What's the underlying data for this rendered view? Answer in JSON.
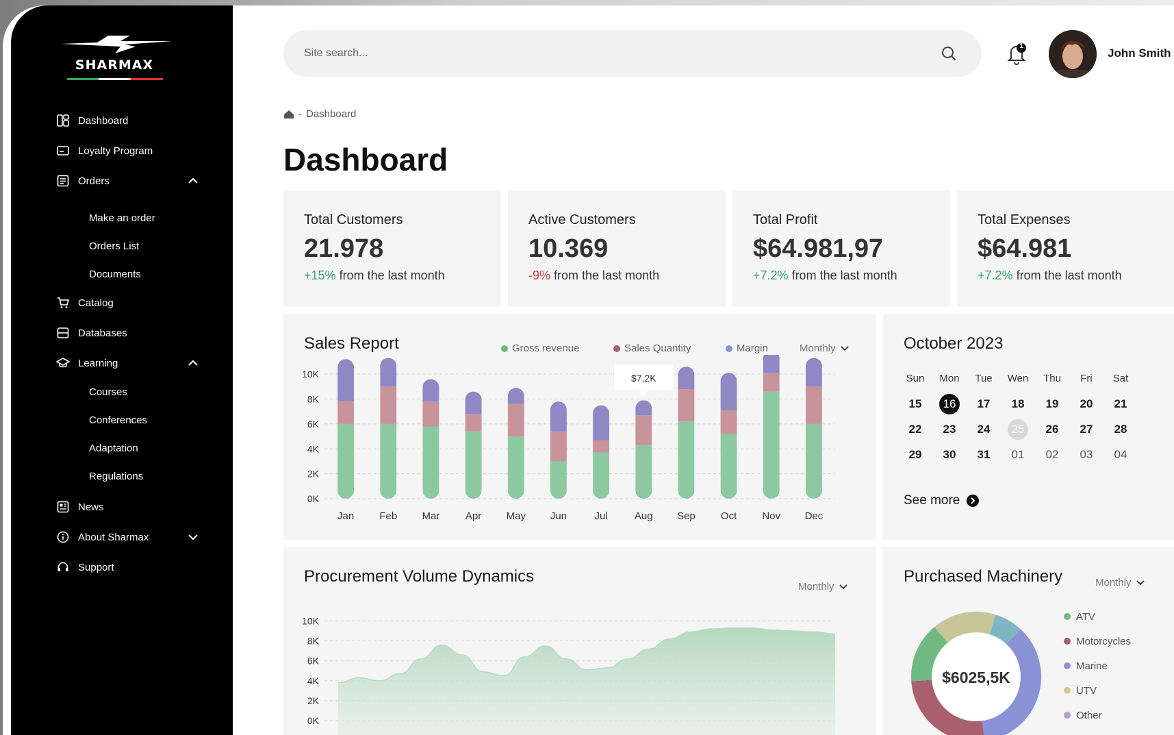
{
  "brand": {
    "name": "SHARMAX"
  },
  "sidebar": {
    "items": [
      {
        "label": "Dashboard"
      },
      {
        "label": "Loyalty Program"
      },
      {
        "label": "Orders",
        "children": [
          "Make an order",
          "Orders List",
          "Documents"
        ]
      },
      {
        "label": "Catalog"
      },
      {
        "label": "Databases"
      },
      {
        "label": "Learning",
        "children": [
          "Courses",
          "Conferences",
          "Adaptation",
          "Regulations"
        ]
      },
      {
        "label": "News"
      },
      {
        "label": "About Sharmax"
      },
      {
        "label": "Support"
      }
    ]
  },
  "header": {
    "search_placeholder": "Site search...",
    "notification_count": "1",
    "user_name": "John Smith"
  },
  "breadcrumb": {
    "separator": "-",
    "current": "Dashboard"
  },
  "page_title": "Dashboard",
  "stats": [
    {
      "title": "Total Customers",
      "value": "21.978",
      "change": "+15%",
      "suffix": "from the last month",
      "trend": "up"
    },
    {
      "title": "Active Customers",
      "value": "10.369",
      "change": "-9%",
      "suffix": "from the last month",
      "trend": "down"
    },
    {
      "title": "Total Profit",
      "value": "$64.981,97",
      "change": "+7.2%",
      "suffix": "from the last month",
      "trend": "up"
    },
    {
      "title": "Total Expenses",
      "value": "$64.981",
      "change": "+7.2%",
      "suffix": "from the last month",
      "trend": "up"
    }
  ],
  "sales_report": {
    "title": "Sales Report",
    "legend": [
      "Gross revenue",
      "Sales Quantity",
      "Margin"
    ],
    "period": "Monthly",
    "tooltip": "$7,2K"
  },
  "calendar": {
    "title": "October 2023",
    "weekdays": [
      "Sun",
      "Mon",
      "Tue",
      "Wen",
      "Thu",
      "Fri",
      "Sat"
    ],
    "weeks": [
      [
        "15",
        "16",
        "17",
        "18",
        "19",
        "20",
        "21"
      ],
      [
        "22",
        "23",
        "24",
        "25",
        "26",
        "27",
        "28"
      ],
      [
        "29",
        "30",
        "31",
        "01",
        "02",
        "03",
        "04"
      ]
    ],
    "today": "16",
    "highlighted": "25",
    "see_more": "See more"
  },
  "procurement": {
    "title": "Procurement Volume Dynamics",
    "period": "Monthly"
  },
  "machinery": {
    "title": "Purchased Machinery",
    "period": "Monthly",
    "total": "$6025,5K",
    "legend": [
      "ATV",
      "Motorcycles",
      "Marine",
      "UTV",
      "Other"
    ]
  },
  "colors": {
    "gross": "#8cc8a0",
    "quantity": "#c8939a",
    "margin": "#8f88c4",
    "utv": "#c8c49a",
    "marine_light": "#7fb6c4",
    "atv": "#6fba82",
    "motorcycles": "#a8606e",
    "marine": "#8a92d6",
    "utv_dot": "#d4c68a",
    "other": "#b59ad6"
  },
  "chart_data": [
    {
      "type": "bar",
      "title": "Sales Report",
      "categories": [
        "Jan",
        "Feb",
        "Mar",
        "Apr",
        "May",
        "Jun",
        "Jul",
        "Aug",
        "Sep",
        "Oct",
        "Nov",
        "Dec"
      ],
      "ylim": [
        0,
        11000
      ],
      "yticks": [
        "0K",
        "2K",
        "4K",
        "6K",
        "8K",
        "10K"
      ],
      "stacked": true,
      "series": [
        {
          "name": "Gross revenue",
          "values": [
            6000,
            6000,
            5800,
            5400,
            5000,
            3000,
            3700,
            4300,
            6200,
            5200,
            8600,
            6000
          ]
        },
        {
          "name": "Sales Quantity",
          "values": [
            1800,
            3000,
            2000,
            1400,
            2600,
            2400,
            1000,
            2400,
            2600,
            1900,
            1500,
            3000
          ]
        },
        {
          "name": "Margin",
          "values": [
            3400,
            2300,
            1800,
            1800,
            1300,
            2400,
            2800,
            1200,
            1800,
            3000,
            1800,
            2300
          ]
        }
      ],
      "annotations": [
        {
          "category": "Aug",
          "text": "$7,2K"
        }
      ]
    },
    {
      "type": "area",
      "title": "Procurement Volume Dynamics",
      "ylim": [
        0,
        11000
      ],
      "yticks": [
        "0K",
        "2K",
        "4K",
        "6K",
        "8K",
        "10K"
      ],
      "x": [
        0,
        1,
        2,
        3,
        4,
        5,
        6,
        7,
        8,
        9,
        10,
        11,
        12,
        13,
        14,
        15,
        16,
        17,
        18,
        19,
        20,
        21,
        22,
        23,
        24
      ],
      "values": [
        3800,
        4300,
        4000,
        4700,
        6200,
        7600,
        6600,
        4900,
        4500,
        6400,
        7500,
        6200,
        5100,
        5300,
        6200,
        7200,
        8200,
        8900,
        9200,
        9300,
        9300,
        9100,
        9000,
        8900,
        8700
      ]
    },
    {
      "type": "pie",
      "title": "Purchased Machinery",
      "categories": [
        "ATV",
        "Motorcycles",
        "Marine",
        "UTV",
        "Other"
      ],
      "values": [
        15,
        26,
        36,
        16,
        7
      ]
    }
  ]
}
